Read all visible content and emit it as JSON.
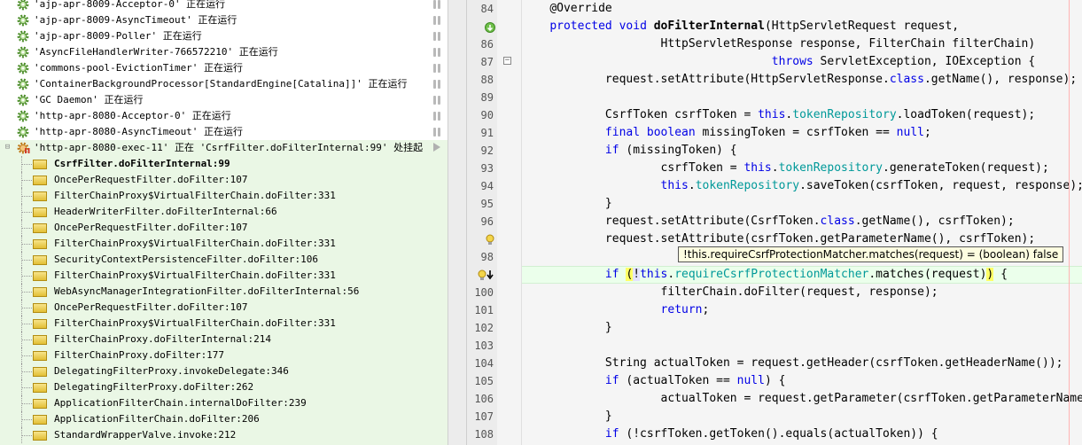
{
  "colors": {
    "keyword": "#0000e6",
    "field": "#009999",
    "thread_frame_bg": "#eaf7e5",
    "current_line_bg": "#ebffeb",
    "tooltip_bg": "#fdfde0"
  },
  "threads": [
    {
      "name": "'ajp-apr-8009-Acceptor-0'",
      "status": "正在运行"
    },
    {
      "name": "'ajp-apr-8009-AsyncTimeout'",
      "status": "正在运行"
    },
    {
      "name": "'ajp-apr-8009-Poller'",
      "status": "正在运行"
    },
    {
      "name": "'AsyncFileHandlerWriter-766572210'",
      "status": "正在运行"
    },
    {
      "name": "'commons-pool-EvictionTimer'",
      "status": "正在运行"
    },
    {
      "name": "'ContainerBackgroundProcessor[StandardEngine[Catalina]]'",
      "status": "正在运行"
    },
    {
      "name": "'GC Daemon'",
      "status": "正在运行"
    },
    {
      "name": "'http-apr-8080-Acceptor-0'",
      "status": "正在运行"
    },
    {
      "name": "'http-apr-8080-AsyncTimeout'",
      "status": "正在运行"
    }
  ],
  "suspended_thread": {
    "name": "'http-apr-8080-exec-11'",
    "status": "正在 'CsrfFilter.doFilterInternal:99' 处挂起"
  },
  "frames": [
    "CsrfFilter.doFilterInternal:99",
    "OncePerRequestFilter.doFilter:107",
    "FilterChainProxy$VirtualFilterChain.doFilter:331",
    "HeaderWriterFilter.doFilterInternal:66",
    "OncePerRequestFilter.doFilter:107",
    "FilterChainProxy$VirtualFilterChain.doFilter:331",
    "SecurityContextPersistenceFilter.doFilter:106",
    "FilterChainProxy$VirtualFilterChain.doFilter:331",
    "WebAsyncManagerIntegrationFilter.doFilterInternal:56",
    "OncePerRequestFilter.doFilter:107",
    "FilterChainProxy$VirtualFilterChain.doFilter:331",
    "FilterChainProxy.doFilterInternal:214",
    "FilterChainProxy.doFilter:177",
    "DelegatingFilterProxy.invokeDelegate:346",
    "DelegatingFilterProxy.doFilter:262",
    "ApplicationFilterChain.internalDoFilter:239",
    "ApplicationFilterChain.doFilter:206",
    "StandardWrapperValve.invoke:212"
  ],
  "editor": {
    "line_numbers": [
      "84",
      "",
      "86",
      "87",
      "88",
      "89",
      "90",
      "91",
      "92",
      "93",
      "94",
      "95",
      "96",
      "",
      "98",
      "",
      "100",
      "101",
      "102",
      "103",
      "104",
      "105",
      "106",
      "107",
      "108"
    ],
    "tooltip": "!this.requireCsrfProtectionMatcher.matches(request) = (boolean) false",
    "lines": [
      [
        {
          "t": "    "
        },
        {
          "t": "@Override"
        }
      ],
      [
        {
          "t": "    "
        },
        {
          "t": "protected",
          "c": "k"
        },
        {
          "t": " "
        },
        {
          "t": "void",
          "c": "k"
        },
        {
          "t": " "
        },
        {
          "t": "doFilterInternal",
          "c": "m"
        },
        {
          "t": "(HttpServletRequest request,"
        }
      ],
      [
        {
          "t": "                    HttpServletResponse response, FilterChain filterChain)"
        }
      ],
      [
        {
          "t": "                                    "
        },
        {
          "t": "throws",
          "c": "k"
        },
        {
          "t": " ServletException, IOException {"
        }
      ],
      [
        {
          "t": "            request.setAttribute(HttpServletResponse."
        },
        {
          "t": "class",
          "c": "k"
        },
        {
          "t": ".getName(), response);"
        }
      ],
      [
        {
          "t": ""
        }
      ],
      [
        {
          "t": "            CsrfToken csrfToken = "
        },
        {
          "t": "this",
          "c": "k"
        },
        {
          "t": "."
        },
        {
          "t": "tokenRepository",
          "c": "f"
        },
        {
          "t": ".loadToken(request);"
        }
      ],
      [
        {
          "t": "            "
        },
        {
          "t": "final",
          "c": "k"
        },
        {
          "t": " "
        },
        {
          "t": "boolean",
          "c": "k"
        },
        {
          "t": " missingToken = csrfToken == "
        },
        {
          "t": "null",
          "c": "k"
        },
        {
          "t": ";"
        }
      ],
      [
        {
          "t": "            "
        },
        {
          "t": "if",
          "c": "k"
        },
        {
          "t": " (missingToken) {"
        }
      ],
      [
        {
          "t": "                    csrfToken = "
        },
        {
          "t": "this",
          "c": "k"
        },
        {
          "t": "."
        },
        {
          "t": "tokenRepository",
          "c": "f"
        },
        {
          "t": ".generateToken(request);"
        }
      ],
      [
        {
          "t": "                    "
        },
        {
          "t": "this",
          "c": "k"
        },
        {
          "t": "."
        },
        {
          "t": "tokenRepository",
          "c": "f"
        },
        {
          "t": ".saveToken(csrfToken, request, response);"
        }
      ],
      [
        {
          "t": "            }"
        }
      ],
      [
        {
          "t": "            request.setAttribute(CsrfToken."
        },
        {
          "t": "class",
          "c": "k"
        },
        {
          "t": ".getName(), csrfToken);"
        }
      ],
      [
        {
          "t": "            request.setAttribute(csrfToken.getParameterName(), csrfToken);"
        }
      ],
      [
        {
          "t": ""
        }
      ],
      [
        {
          "t": "            "
        },
        {
          "t": "if",
          "c": "k"
        },
        {
          "t": " "
        },
        {
          "t": "(",
          "c": "hlp"
        },
        {
          "t": "!",
          "c": "hl2"
        },
        {
          "t": "this",
          "c": "k"
        },
        {
          "t": "."
        },
        {
          "t": "requireCsrfProtectionMatcher",
          "c": "f"
        },
        {
          "t": ".matches(request)"
        },
        {
          "t": ")",
          "c": "hlp"
        },
        {
          "t": " {"
        }
      ],
      [
        {
          "t": "                    filterChain.doFilter(request, response);"
        }
      ],
      [
        {
          "t": "                    "
        },
        {
          "t": "return",
          "c": "k"
        },
        {
          "t": ";"
        }
      ],
      [
        {
          "t": "            }"
        }
      ],
      [
        {
          "t": ""
        }
      ],
      [
        {
          "t": "            String actualToken = request.getHeader(csrfToken.getHeaderName());"
        }
      ],
      [
        {
          "t": "            "
        },
        {
          "t": "if",
          "c": "k"
        },
        {
          "t": " (actualToken == "
        },
        {
          "t": "null",
          "c": "k"
        },
        {
          "t": ") {"
        }
      ],
      [
        {
          "t": "                    actualToken = request.getParameter(csrfToken.getParameterName());"
        }
      ],
      [
        {
          "t": "            }"
        }
      ],
      [
        {
          "t": "            "
        },
        {
          "t": "if",
          "c": "k"
        },
        {
          "t": " (!csrfToken.getToken().equals(actualToken)) {"
        }
      ]
    ]
  }
}
